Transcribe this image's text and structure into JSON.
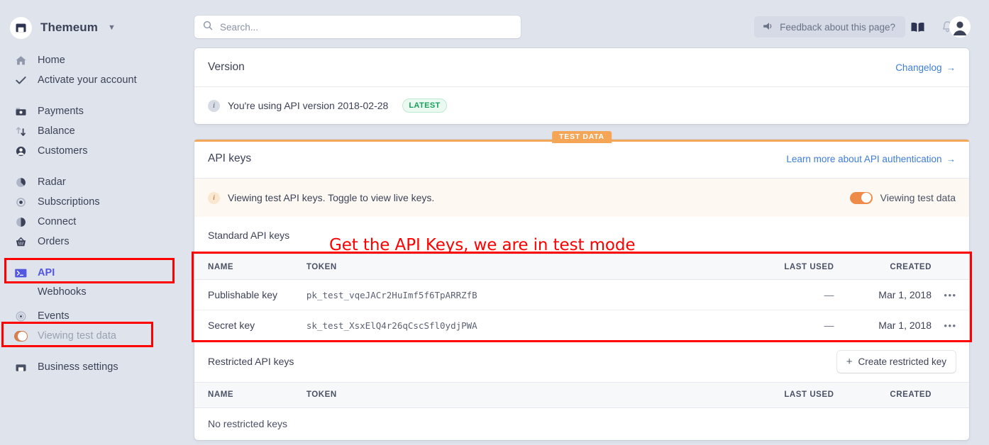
{
  "sidebar": {
    "brand": {
      "name": "Themeum",
      "caret": "chevron-down-icon"
    },
    "items": [
      {
        "label": "Home",
        "icon": "home-icon"
      },
      {
        "label": "Activate your account",
        "icon": "check-icon"
      },
      {
        "label": "Payments",
        "icon": "payments-icon"
      },
      {
        "label": "Balance",
        "icon": "balance-icon"
      },
      {
        "label": "Customers",
        "icon": "customers-icon"
      },
      {
        "label": "Radar",
        "icon": "radar-icon"
      },
      {
        "label": "Subscriptions",
        "icon": "subscriptions-icon"
      },
      {
        "label": "Connect",
        "icon": "connect-icon"
      },
      {
        "label": "Orders",
        "icon": "orders-icon"
      },
      {
        "label": "API",
        "icon": "api-terminal-icon"
      },
      {
        "label": "Webhooks",
        "icon": ""
      },
      {
        "label": "Events",
        "icon": "events-icon"
      },
      {
        "label": "Viewing test data",
        "icon": "toggle-icon"
      },
      {
        "label": "Business settings",
        "icon": "business-settings-icon"
      }
    ]
  },
  "topbar": {
    "search_placeholder": "Search...",
    "feedback_label": "Feedback about this page?",
    "icons": [
      "megaphone-icon",
      "docs-book-icon",
      "notifications-bell-icon",
      "avatar"
    ]
  },
  "version_card": {
    "title": "Version",
    "link": "Changelog",
    "link_arrow": "→",
    "message": "You're using API version 2018-02-28",
    "badge": "LATEST"
  },
  "api_card": {
    "ribbon": "TEST DATA",
    "title": "API keys",
    "link": "Learn more about API authentication",
    "link_arrow": "→",
    "banner_message": "Viewing test API keys. Toggle to view live keys.",
    "toggle_label": "Viewing test data",
    "standard": {
      "section_title": "Standard API keys",
      "columns": [
        "NAME",
        "TOKEN",
        "LAST USED",
        "CREATED"
      ],
      "rows": [
        {
          "name": "Publishable key",
          "token": "pk_test_vqeJACr2HuImf5f6TpARRZfB",
          "last_used": "—",
          "created": "Mar 1, 2018",
          "menu": "•••"
        },
        {
          "name": "Secret key",
          "token": "sk_test_XsxElQ4r26qCscSfl0ydjPWA",
          "last_used": "—",
          "created": "Mar 1, 2018",
          "menu": "•••"
        }
      ]
    },
    "restricted": {
      "section_title": "Restricted API keys",
      "create_button": "Create restricted key",
      "create_plus": "+",
      "columns": [
        "NAME",
        "TOKEN",
        "LAST USED",
        "CREATED"
      ],
      "empty_text": "No restricted keys"
    }
  },
  "annotations": {
    "note": "Get the API Keys, we are in test mode",
    "color": "#ff0000",
    "boxes": [
      "sidebar-api-item",
      "sidebar-viewing-test-data",
      "standard-api-keys-table"
    ]
  },
  "colors": {
    "sidebar_bg": "#dfe3ec",
    "accent_blue": "#5356e0",
    "link_blue": "#3d7ddb",
    "test_orange": "#f5a556",
    "toggle_orange": "#ef8b48",
    "badge_green": "#17a05b",
    "annotation_red": "#ff0000"
  }
}
